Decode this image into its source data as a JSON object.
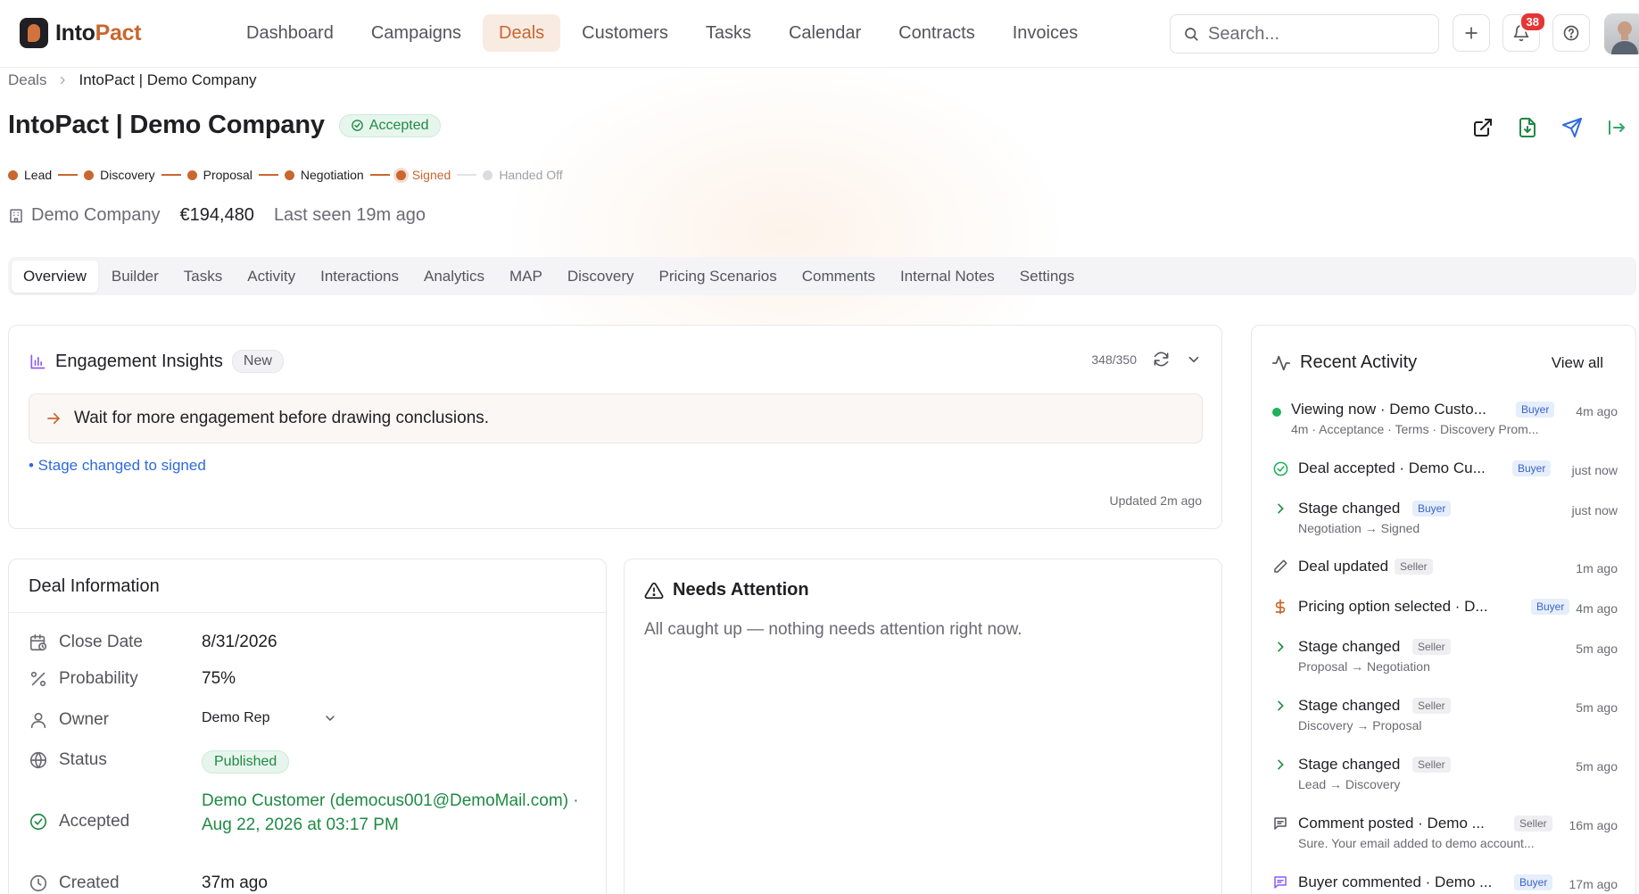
{
  "brand": {
    "name_part1": "Into",
    "name_part2": "Pact"
  },
  "nav": {
    "items": [
      {
        "label": "Dashboard"
      },
      {
        "label": "Campaigns"
      },
      {
        "label": "Deals",
        "active": true
      },
      {
        "label": "Customers"
      },
      {
        "label": "Tasks"
      },
      {
        "label": "Calendar"
      },
      {
        "label": "Contracts"
      },
      {
        "label": "Invoices"
      }
    ]
  },
  "search": {
    "placeholder": "Search..."
  },
  "notifications": {
    "count": "38"
  },
  "breadcrumb": {
    "parent": "Deals",
    "current": "IntoPact | Demo Company"
  },
  "deal": {
    "title": "IntoPact | Demo Company",
    "status": "Accepted",
    "company": "Demo Company",
    "amount": "€194,480",
    "last_seen": "Last seen 19m ago"
  },
  "stages": [
    {
      "label": "Lead",
      "state": "done"
    },
    {
      "label": "Discovery",
      "state": "done"
    },
    {
      "label": "Proposal",
      "state": "done"
    },
    {
      "label": "Negotiation",
      "state": "done"
    },
    {
      "label": "Signed",
      "state": "current"
    },
    {
      "label": "Handed Off",
      "state": "pending"
    }
  ],
  "tabs": [
    {
      "label": "Overview",
      "active": true
    },
    {
      "label": "Builder"
    },
    {
      "label": "Tasks"
    },
    {
      "label": "Activity"
    },
    {
      "label": "Interactions"
    },
    {
      "label": "Analytics"
    },
    {
      "label": "MAP"
    },
    {
      "label": "Discovery"
    },
    {
      "label": "Pricing Scenarios"
    },
    {
      "label": "Comments"
    },
    {
      "label": "Internal Notes"
    },
    {
      "label": "Settings"
    }
  ],
  "insights": {
    "title": "Engagement Insights",
    "tag": "New",
    "quota": "348/350",
    "message": "Wait for more engagement before drawing conclusions.",
    "bullet": "• Stage changed to signed",
    "updated": "Updated 2m ago"
  },
  "deal_info": {
    "title": "Deal Information",
    "close_date_label": "Close Date",
    "close_date": "8/31/2026",
    "probability_label": "Probability",
    "probability": "75%",
    "owner_label": "Owner",
    "owner": "Demo Rep",
    "status_label": "Status",
    "status": "Published",
    "accepted_label": "Accepted",
    "accepted": "Demo Customer (democus001@DemoMail.com) · Aug 22, 2026 at 03:17 PM",
    "created_label": "Created",
    "created": "37m ago"
  },
  "attention": {
    "title": "Needs Attention",
    "message": "All caught up — nothing needs attention right now."
  },
  "activity": {
    "title": "Recent Activity",
    "view_all": "View all",
    "items": [
      {
        "icon": "live-dot-icon",
        "title": "Viewing now · Demo Custo...",
        "role": "Buyer",
        "time": "4m ago",
        "sub": "4m · Acceptance · Terms · Discovery Prom..."
      },
      {
        "icon": "check-circle-icon",
        "title": "Deal accepted · Demo Cu...",
        "role": "Buyer",
        "time": "just now",
        "sub": ""
      },
      {
        "icon": "chevron-right-icon",
        "title": "Stage changed",
        "role": "Buyer",
        "time": "just now",
        "sub": "Negotiation → Signed"
      },
      {
        "icon": "pencil-icon",
        "title": "Deal updated",
        "role": "Seller",
        "time": "1m ago",
        "sub": ""
      },
      {
        "icon": "dollar-icon",
        "title": "Pricing option selected · D...",
        "role": "Buyer",
        "time": "4m ago",
        "sub": ""
      },
      {
        "icon": "chevron-right-icon",
        "title": "Stage changed",
        "role": "Seller",
        "time": "5m ago",
        "sub": "Proposal → Negotiation"
      },
      {
        "icon": "chevron-right-icon",
        "title": "Stage changed",
        "role": "Seller",
        "time": "5m ago",
        "sub": "Discovery → Proposal"
      },
      {
        "icon": "chevron-right-icon",
        "title": "Stage changed",
        "role": "Seller",
        "time": "5m ago",
        "sub": "Lead → Discovery"
      },
      {
        "icon": "comment-icon",
        "title": "Comment posted · Demo ...",
        "role": "Seller",
        "time": "16m ago",
        "sub": "Sure. Your email added to demo account..."
      },
      {
        "icon": "comment-icon",
        "title": "Buyer commented · Demo ...",
        "role": "Buyer",
        "time": "17m ago",
        "sub": ""
      }
    ]
  },
  "colors": {
    "accent": "#c8672f",
    "success": "#1f8a44",
    "link": "#2f6bdc",
    "badge": "#e53535"
  }
}
